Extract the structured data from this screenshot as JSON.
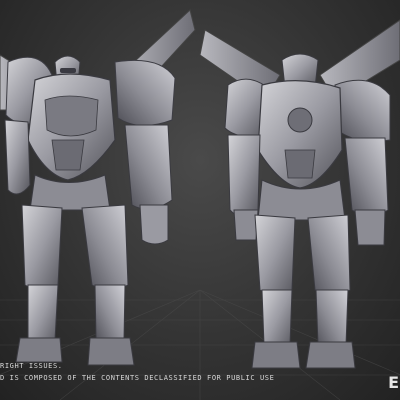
{
  "scene": {
    "subject": "Two 3D sculpt renders of a winged armored mech robot (front view and rear view)",
    "colors": {
      "background_center": "#4a4a4a",
      "background_edge": "#222222",
      "metal_light": "#c8c8cc",
      "metal_mid": "#8f8f96",
      "metal_dark": "#4e4e55",
      "grid_line": "#555555"
    }
  },
  "caption": {
    "line1": "RIGHT ISSUES.",
    "line2": "D IS COMPOSED OF THE CONTENTS DECLASSIFIED FOR PUBLIC USE"
  },
  "brand": {
    "text": "E"
  }
}
